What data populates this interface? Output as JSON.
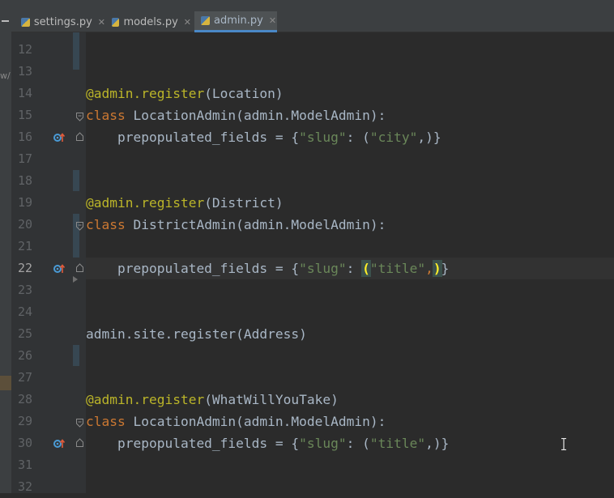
{
  "tabs": [
    {
      "label": "settings.py",
      "active": false
    },
    {
      "label": "models.py",
      "active": false
    },
    {
      "label": "admin.py",
      "active": true
    }
  ],
  "left_strip": {
    "text": "w/"
  },
  "line_numbers": [
    "12",
    "13",
    "14",
    "15",
    "16",
    "17",
    "18",
    "19",
    "20",
    "21",
    "22",
    "23",
    "24",
    "25",
    "26",
    "27",
    "28",
    "29",
    "30",
    "31",
    "32"
  ],
  "current_line": "22",
  "code": {
    "l14": {
      "dec": "@admin.register",
      "rest": "(Location)"
    },
    "l15": {
      "kw": "class",
      "rest": " LocationAdmin(admin.ModelAdmin):"
    },
    "l16": {
      "pre": "    prepopulated_fields = {",
      "s1": "\"slug\"",
      "mid": ": (",
      "s2": "\"city\"",
      "post": ",)}"
    },
    "l19": {
      "dec": "@admin.register",
      "rest": "(District)"
    },
    "l20": {
      "kw": "class",
      "rest": " DistrictAdmin(admin.ModelAdmin):"
    },
    "l22": {
      "pre": "    prepopulated_fields = {",
      "s1": "\"slug\"",
      "mid": ": ",
      "open": "(",
      "s2": "\"title\"",
      "comma": ",",
      "close": ")",
      "post": "}"
    },
    "l25": {
      "text": "admin.site.register(Address)"
    },
    "l28": {
      "dec": "@admin.register",
      "rest": "(WhatWillYouTake)"
    },
    "l29": {
      "kw": "class",
      "rest": " LocationAdmin(admin.ModelAdmin):"
    },
    "l30": {
      "pre": "    prepopulated_fields = {",
      "s1": "\"slug\"",
      "mid": ": (",
      "s2": "\"title\"",
      "post": ",)}"
    }
  },
  "colors": {
    "background": "#2b2b2b",
    "decorator": "#bbb529",
    "keyword": "#cc7832",
    "string": "#6a8759",
    "text": "#a9b7c6",
    "override_icon": "#4a9bd6",
    "override_arrow": "#e05a3a"
  },
  "icons": [
    "python-file-icon",
    "close-icon",
    "override-method-icon",
    "fold-marker-icon",
    "text-cursor-icon"
  ]
}
